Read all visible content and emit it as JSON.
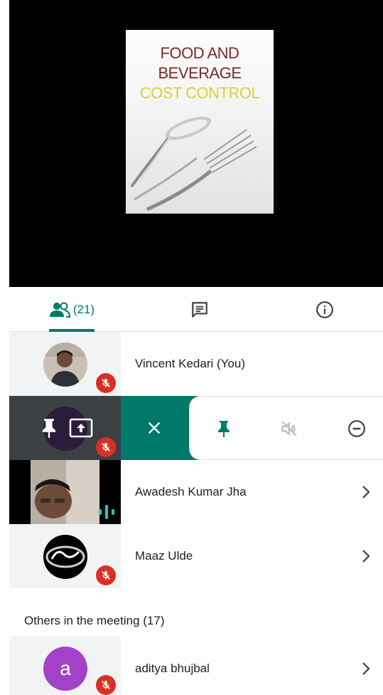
{
  "presentation": {
    "book_title_line1": "FOOD AND",
    "book_title_line2": "BEVERAGE",
    "book_title_line3": "COST CONTROL"
  },
  "tabs": {
    "people_count": "(21)",
    "people_icon": "people-icon",
    "chat_icon": "chat-icon",
    "info_icon": "info-icon"
  },
  "participants": [
    {
      "name": "Vincent Kedari (You)",
      "muted": true
    },
    {
      "name": "",
      "muted": true,
      "selected": true
    },
    {
      "name": "Awadesh Kumar Jha",
      "speaking": true
    },
    {
      "name": "Maaz Ulde",
      "muted": true
    }
  ],
  "action_bar": {
    "icons": [
      "pin-icon",
      "present-icon",
      "close-icon",
      "pin-icon",
      "mute-icon",
      "remove-icon"
    ]
  },
  "others_section": {
    "label": "Others in the meeting (17)",
    "items": [
      {
        "name": "aditya bhujbal",
        "avatar_letter": "a",
        "avatar_color": "#a142c9",
        "muted": true
      }
    ]
  },
  "colors": {
    "accent": "#00796b",
    "muted_badge": "#d93025",
    "speaking": "#1fd0c1"
  }
}
